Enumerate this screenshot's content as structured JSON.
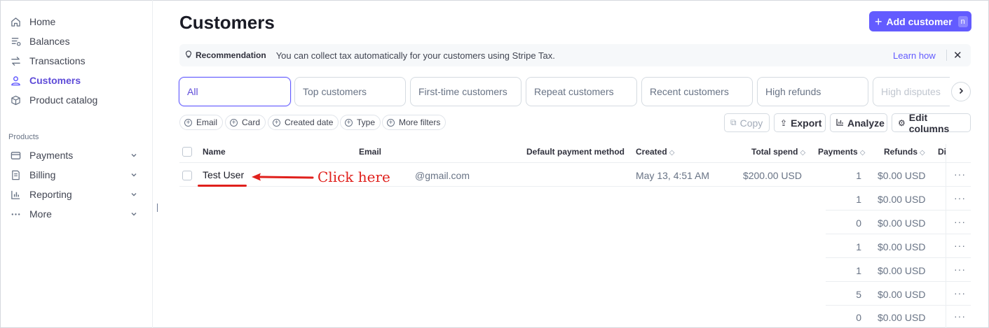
{
  "sidebar": {
    "items": [
      {
        "label": "Home",
        "icon": "home-icon"
      },
      {
        "label": "Balances",
        "icon": "balances-icon"
      },
      {
        "label": "Transactions",
        "icon": "transactions-icon"
      },
      {
        "label": "Customers",
        "icon": "customers-icon",
        "active": true
      },
      {
        "label": "Product catalog",
        "icon": "product-catalog-icon"
      }
    ],
    "section_label": "Products",
    "product_items": [
      {
        "label": "Payments",
        "icon": "payments-icon"
      },
      {
        "label": "Billing",
        "icon": "billing-icon"
      },
      {
        "label": "Reporting",
        "icon": "reporting-icon"
      },
      {
        "label": "More",
        "icon": "more-icon"
      }
    ]
  },
  "header": {
    "title": "Customers",
    "add_label": "Add customer",
    "add_shortcut": "n"
  },
  "recommendation": {
    "label": "Recommendation",
    "text": "You can collect tax automatically for your customers using Stripe Tax.",
    "link": "Learn how"
  },
  "tabs": [
    "All",
    "Top customers",
    "First-time customers",
    "Repeat customers",
    "Recent customers",
    "High refunds",
    "High disputes"
  ],
  "filters": [
    "Email",
    "Card",
    "Created date",
    "Type",
    "More filters"
  ],
  "actions": {
    "copy": "Copy",
    "export": "Export",
    "analyze": "Analyze",
    "edit_columns": "Edit columns"
  },
  "table": {
    "columns": {
      "name": "Name",
      "email": "Email",
      "payment_method": "Default payment method",
      "created": "Created",
      "total_spend": "Total spend",
      "payments": "Payments",
      "refunds": "Refunds",
      "disputes": "Di"
    },
    "first_row": {
      "name": "Test User",
      "email": "@gmail.com",
      "created": "May 13, 4:51 AM",
      "total_spend": "$200.00 USD",
      "payments": "1",
      "refunds": "$0.00 USD"
    },
    "rows": [
      {
        "payments": "1",
        "refunds": "$0.00 USD"
      },
      {
        "payments": "0",
        "refunds": "$0.00 USD"
      },
      {
        "payments": "1",
        "refunds": "$0.00 USD"
      },
      {
        "payments": "1",
        "refunds": "$0.00 USD"
      },
      {
        "payments": "5",
        "refunds": "$0.00 USD"
      },
      {
        "payments": "0",
        "refunds": "$0.00 USD"
      }
    ]
  },
  "annotation": {
    "text": "Click here",
    "color": "#e0201c"
  },
  "colors": {
    "accent": "#635bff"
  }
}
